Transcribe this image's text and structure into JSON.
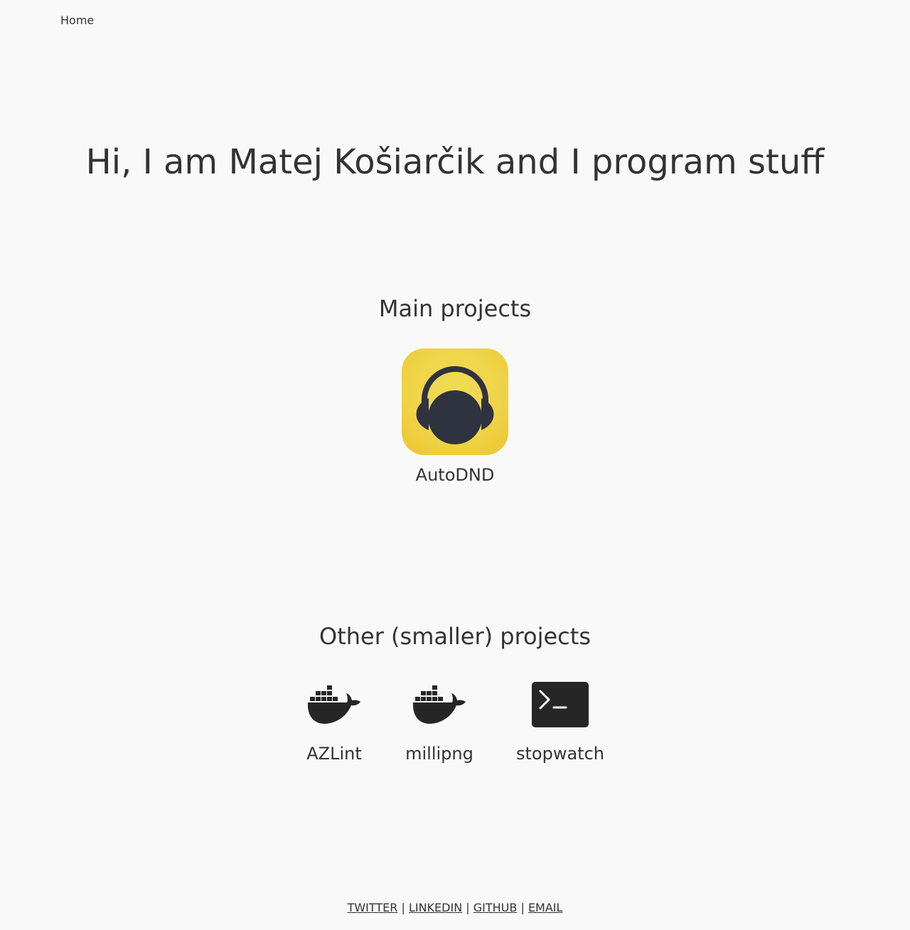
{
  "nav": {
    "home_label": "Home"
  },
  "hero": {
    "title": "Hi, I am Matej Košiarčik and I program stuff"
  },
  "main_projects": {
    "title": "Main projects",
    "items": [
      {
        "label": "AutoDND",
        "icon": "headphones-icon",
        "icon_bg": "#efd448",
        "icon_fg": "#2f3340"
      }
    ]
  },
  "other_projects": {
    "title": "Other (smaller) projects",
    "items": [
      {
        "label": "AZLint",
        "icon": "docker-whale-icon"
      },
      {
        "label": "millipng",
        "icon": "docker-whale-icon"
      },
      {
        "label": "stopwatch",
        "icon": "terminal-icon"
      }
    ]
  },
  "footer": {
    "links": [
      "TWITTER",
      "LINKEDIN",
      "GITHUB",
      "EMAIL"
    ],
    "separator": "|"
  },
  "colors": {
    "background": "#f9f9f9",
    "text": "#333333",
    "icon_dark": "#262626"
  }
}
